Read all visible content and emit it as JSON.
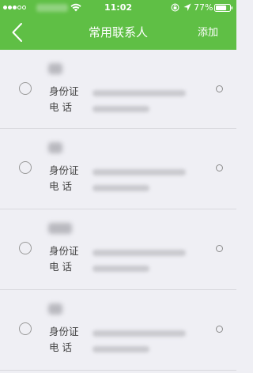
{
  "colors": {
    "accent": "#5fbf45",
    "background": "#efeff4",
    "divider": "#d9d9de"
  },
  "status_bar": {
    "time": "11:02",
    "battery_percent": "77%",
    "signal_icon": "signal-dots-icon",
    "wifi_icon": "wifi-icon",
    "rotation_lock_icon": "rotation-lock-icon",
    "location_icon": "location-arrow-icon",
    "battery_icon": "battery-icon",
    "battery_level": 0.77
  },
  "nav": {
    "back_icon": "chevron-left-icon",
    "title": "常用联系人",
    "add_label": "添加"
  },
  "contacts": [
    {
      "id_label": "身份证",
      "phone_label": "电话"
    },
    {
      "id_label": "身份证",
      "phone_label": "电话"
    },
    {
      "id_label": "身份证",
      "phone_label": "电话"
    },
    {
      "id_label": "身份证",
      "phone_label": "电话"
    }
  ]
}
